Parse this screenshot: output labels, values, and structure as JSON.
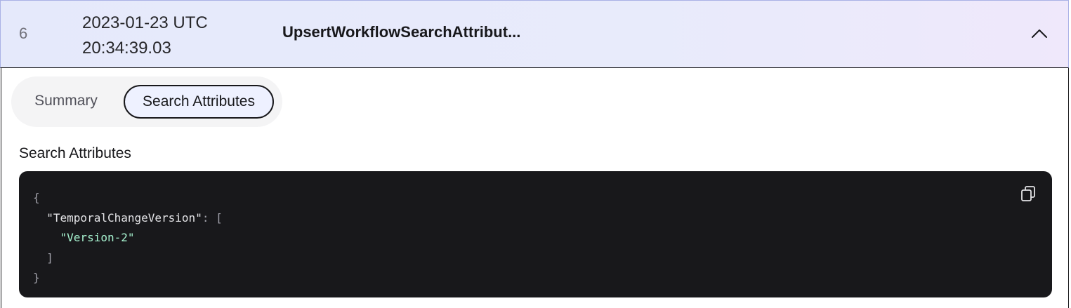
{
  "event_row": {
    "id": "6",
    "timestamp_date": "2023-01-23 UTC",
    "timestamp_time": "20:34:39.03",
    "event_type": "UpsertWorkflowSearchAttribut..."
  },
  "tabs": [
    {
      "label": "Summary",
      "active": false
    },
    {
      "label": "Search Attributes",
      "active": true
    }
  ],
  "section": {
    "heading": "Search Attributes"
  },
  "code": {
    "open_brace": "{",
    "key": "\"TemporalChangeVersion\"",
    "colon_bracket": ": [",
    "value": "\"Version-2\"",
    "close_bracket": "]",
    "close_brace": "}"
  },
  "icons": {
    "toggle": "chevron-up-icon",
    "copy": "copy-icon"
  },
  "colors": {
    "row_gradient_start": "#e5e9fb",
    "row_gradient_end": "#efe8fb",
    "code_background": "#18181b",
    "string_color": "#a7f3d0",
    "active_tab_background": "#eef1ff"
  }
}
